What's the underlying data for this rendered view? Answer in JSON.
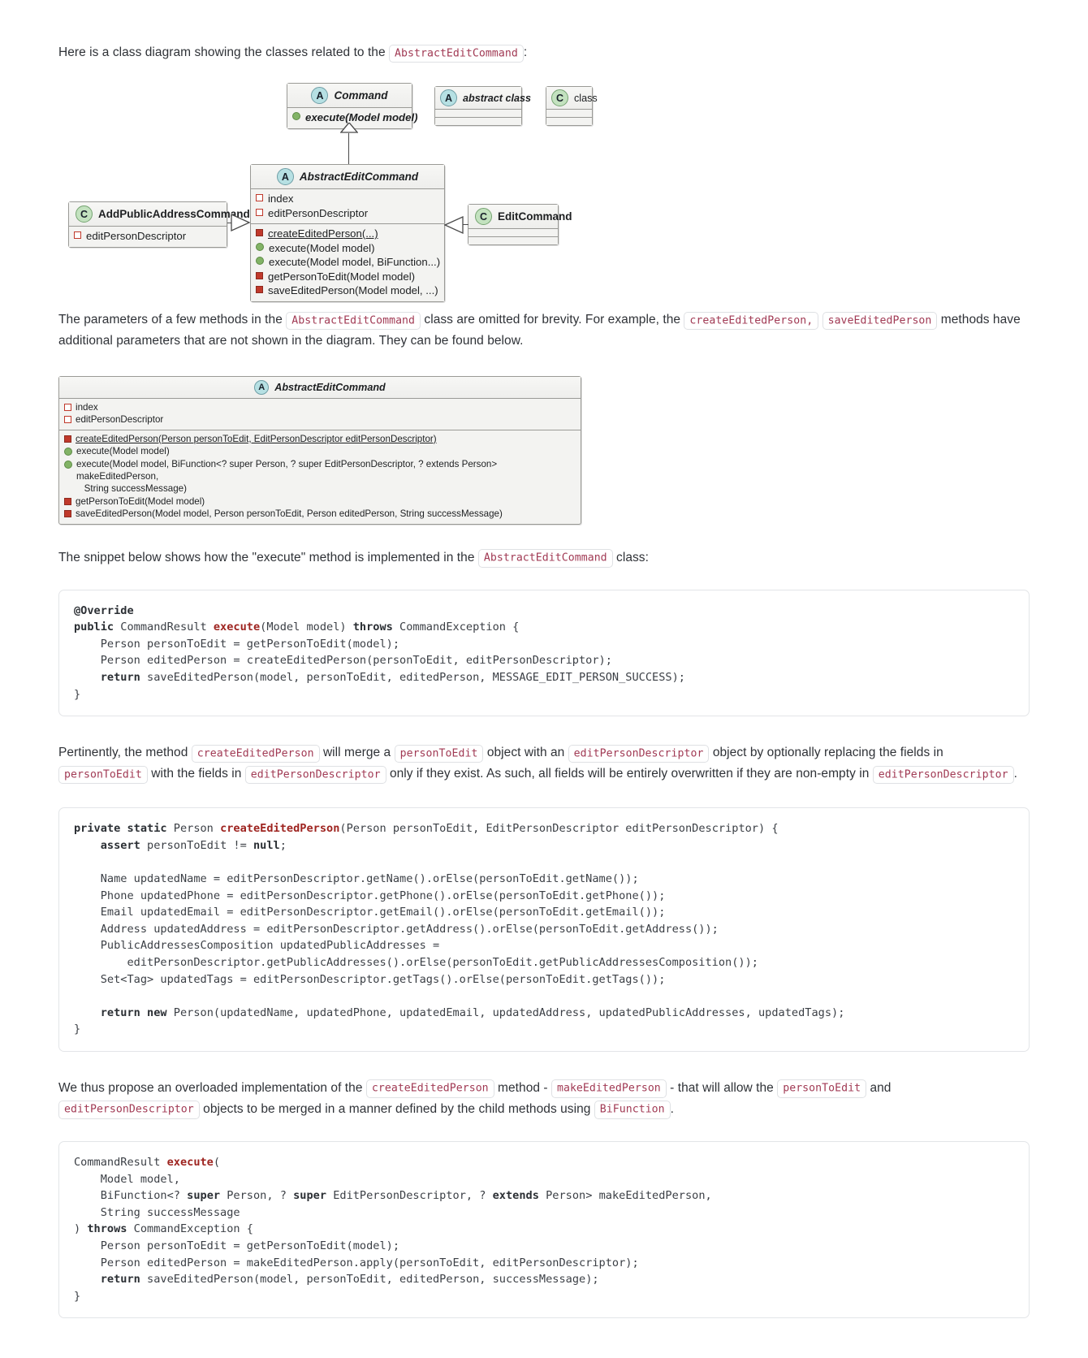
{
  "doc": {
    "intro_p1_a": "Here is a class diagram showing the classes related to the",
    "intro_p1_code": "AbstractEditCommand",
    "intro_p1_b": ":",
    "p2_a": "The parameters of a few methods in the",
    "p2_code1": "AbstractEditCommand",
    "p2_b": "class are omitted for brevity. For example, the",
    "p2_code2": "createEditedPerson,",
    "p2_code3": "saveEditedPerson",
    "p2_c": "methods have additional parameters that are not shown in the diagram. They can be found below.",
    "p3_a": "The snippet below shows how the \"execute\" method is implemented in the",
    "p3_code": "AbstractEditCommand",
    "p3_b": "class:",
    "p4_a": "Pertinently, the method",
    "p4_code1": "createEditedPerson",
    "p4_b": "will merge a",
    "p4_code2": "personToEdit",
    "p4_c": "object with an",
    "p4_code3": "editPersonDescriptor",
    "p4_d": "object by optionally replacing the fields in",
    "p4_code4": "personToEdit",
    "p4_e": "with the fields in",
    "p4_code5": "editPersonDescriptor",
    "p4_f": "only if they exist. As such, all fields will be entirely overwritten if they are non-empty in",
    "p4_code6": "editPersonDescriptor",
    "p4_g": ".",
    "p5_a": "We thus propose an overloaded implementation of the",
    "p5_code1": "createEditedPerson",
    "p5_b": "method -",
    "p5_code2": "makeEditedPerson",
    "p5_c": "- that will allow the",
    "p5_code3": "personToEdit",
    "p5_d": "and",
    "p5_code4": "editPersonDescriptor",
    "p5_e": "objects to be merged in a manner defined by the child methods using",
    "p5_code5": "BiFunction",
    "p5_f": "."
  },
  "diagram1": {
    "command": {
      "badge": "A",
      "title": "Command",
      "methods": [
        {
          "marker": "pubmeth",
          "text": "execute(Model model)",
          "static": false
        }
      ]
    },
    "legend_abstract": {
      "badge": "A",
      "title": "abstract class"
    },
    "legend_class": {
      "badge": "C",
      "title": "class"
    },
    "abstract_edit_command": {
      "badge": "A",
      "title": "AbstractEditCommand",
      "fields": [
        {
          "marker": "privfield",
          "text": "index"
        },
        {
          "marker": "privfield",
          "text": "editPersonDescriptor"
        }
      ],
      "methods": [
        {
          "marker": "privmeth",
          "text": "createEditedPerson(...)",
          "static": true
        },
        {
          "marker": "pubmeth",
          "text": "execute(Model model)",
          "static": false
        },
        {
          "marker": "pubmeth",
          "text": "execute(Model model, BiFunction...)",
          "static": false
        },
        {
          "marker": "privmeth",
          "text": "getPersonToEdit(Model model)",
          "static": false
        },
        {
          "marker": "privmeth",
          "text": "saveEditedPerson(Model model, ...)",
          "static": false
        }
      ]
    },
    "add_public_address_command": {
      "badge": "C",
      "title": "AddPublicAddressCommand",
      "fields": [
        {
          "marker": "privfield",
          "text": "editPersonDescriptor"
        }
      ]
    },
    "edit_command": {
      "badge": "C",
      "title": "EditCommand"
    }
  },
  "diagram2": {
    "badge": "A",
    "title": "AbstractEditCommand",
    "fields": [
      {
        "marker": "privfield",
        "text": "index"
      },
      {
        "marker": "privfield",
        "text": "editPersonDescriptor"
      }
    ],
    "methods": [
      {
        "marker": "privmeth",
        "static": true,
        "text": "createEditedPerson(Person personToEdit, EditPersonDescriptor editPersonDescriptor)"
      },
      {
        "marker": "pubmeth",
        "static": false,
        "text": "execute(Model model)"
      },
      {
        "marker": "pubmeth",
        "static": false,
        "text": "execute(Model model, BiFunction<? super Person, ? super EditPersonDescriptor, ? extends Person> makeEditedPerson,\n   String successMessage)"
      },
      {
        "marker": "privmeth",
        "static": false,
        "text": "getPersonToEdit(Model model)"
      },
      {
        "marker": "privmeth",
        "static": false,
        "text": "saveEditedPerson(Model model, Person personToEdit, Person editedPerson, String successMessage)"
      }
    ]
  },
  "code1": [
    {
      "t": "ann",
      "v": "@Override"
    },
    {
      "t": "nl"
    },
    {
      "t": "kw",
      "v": "public"
    },
    {
      "t": "p",
      "v": " CommandResult "
    },
    {
      "t": "fn",
      "v": "execute"
    },
    {
      "t": "p",
      "v": "(Model model) "
    },
    {
      "t": "kw",
      "v": "throws"
    },
    {
      "t": "p",
      "v": " CommandException {"
    },
    {
      "t": "nl"
    },
    {
      "t": "p",
      "v": "    Person personToEdit = getPersonToEdit(model);"
    },
    {
      "t": "nl"
    },
    {
      "t": "p",
      "v": "    Person editedPerson = createEditedPerson(personToEdit, editPersonDescriptor);"
    },
    {
      "t": "nl"
    },
    {
      "t": "p",
      "v": "    "
    },
    {
      "t": "kw",
      "v": "return"
    },
    {
      "t": "p",
      "v": " saveEditedPerson(model, personToEdit, editedPerson, MESSAGE_EDIT_PERSON_SUCCESS);"
    },
    {
      "t": "nl"
    },
    {
      "t": "p",
      "v": "}"
    }
  ],
  "code2": [
    {
      "t": "kw",
      "v": "private static"
    },
    {
      "t": "p",
      "v": " Person "
    },
    {
      "t": "fn",
      "v": "createEditedPerson"
    },
    {
      "t": "p",
      "v": "(Person personToEdit, EditPersonDescriptor editPersonDescriptor) {"
    },
    {
      "t": "nl"
    },
    {
      "t": "p",
      "v": "    "
    },
    {
      "t": "kw",
      "v": "assert"
    },
    {
      "t": "p",
      "v": " personToEdit != "
    },
    {
      "t": "kw",
      "v": "null"
    },
    {
      "t": "p",
      "v": ";"
    },
    {
      "t": "nl"
    },
    {
      "t": "nl"
    },
    {
      "t": "p",
      "v": "    Name updatedName = editPersonDescriptor.getName().orElse(personToEdit.getName());"
    },
    {
      "t": "nl"
    },
    {
      "t": "p",
      "v": "    Phone updatedPhone = editPersonDescriptor.getPhone().orElse(personToEdit.getPhone());"
    },
    {
      "t": "nl"
    },
    {
      "t": "p",
      "v": "    Email updatedEmail = editPersonDescriptor.getEmail().orElse(personToEdit.getEmail());"
    },
    {
      "t": "nl"
    },
    {
      "t": "p",
      "v": "    Address updatedAddress = editPersonDescriptor.getAddress().orElse(personToEdit.getAddress());"
    },
    {
      "t": "nl"
    },
    {
      "t": "p",
      "v": "    PublicAddressesComposition updatedPublicAddresses ="
    },
    {
      "t": "nl"
    },
    {
      "t": "p",
      "v": "        editPersonDescriptor.getPublicAddresses().orElse(personToEdit.getPublicAddressesComposition());"
    },
    {
      "t": "nl"
    },
    {
      "t": "p",
      "v": "    Set<Tag> updatedTags = editPersonDescriptor.getTags().orElse(personToEdit.getTags());"
    },
    {
      "t": "nl"
    },
    {
      "t": "nl"
    },
    {
      "t": "p",
      "v": "    "
    },
    {
      "t": "kw",
      "v": "return new"
    },
    {
      "t": "p",
      "v": " Person(updatedName, updatedPhone, updatedEmail, updatedAddress, updatedPublicAddresses, updatedTags);"
    },
    {
      "t": "nl"
    },
    {
      "t": "p",
      "v": "}"
    }
  ],
  "code3": [
    {
      "t": "p",
      "v": "CommandResult "
    },
    {
      "t": "fn",
      "v": "execute"
    },
    {
      "t": "p",
      "v": "("
    },
    {
      "t": "nl"
    },
    {
      "t": "p",
      "v": "    Model model,"
    },
    {
      "t": "nl"
    },
    {
      "t": "p",
      "v": "    BiFunction<? "
    },
    {
      "t": "kw",
      "v": "super"
    },
    {
      "t": "p",
      "v": " Person, ? "
    },
    {
      "t": "kw",
      "v": "super"
    },
    {
      "t": "p",
      "v": " EditPersonDescriptor, ? "
    },
    {
      "t": "kw",
      "v": "extends"
    },
    {
      "t": "p",
      "v": " Person> makeEditedPerson,"
    },
    {
      "t": "nl"
    },
    {
      "t": "p",
      "v": "    String successMessage"
    },
    {
      "t": "nl"
    },
    {
      "t": "p",
      "v": ") "
    },
    {
      "t": "kw",
      "v": "throws"
    },
    {
      "t": "p",
      "v": " CommandException {"
    },
    {
      "t": "nl"
    },
    {
      "t": "p",
      "v": "    Person personToEdit = getPersonToEdit(model);"
    },
    {
      "t": "nl"
    },
    {
      "t": "p",
      "v": "    Person editedPerson = makeEditedPerson.apply(personToEdit, editPersonDescriptor);"
    },
    {
      "t": "nl"
    },
    {
      "t": "p",
      "v": "    "
    },
    {
      "t": "kw",
      "v": "return"
    },
    {
      "t": "p",
      "v": " saveEditedPerson(model, personToEdit, editedPerson, successMessage);"
    },
    {
      "t": "nl"
    },
    {
      "t": "p",
      "v": "}"
    }
  ]
}
